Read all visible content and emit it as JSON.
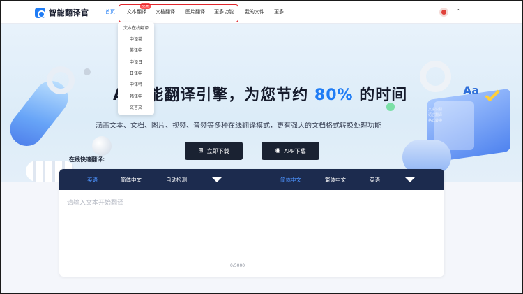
{
  "header": {
    "app_name": "智能翻译官",
    "nav": [
      {
        "label": "首页",
        "active": true
      },
      {
        "label": "文本翻译",
        "active": false,
        "badge": "免费"
      },
      {
        "label": "文档翻译",
        "active": false
      },
      {
        "label": "图片翻译",
        "active": false
      },
      {
        "label": "更多功能",
        "active": false
      },
      {
        "label": "我的文件",
        "active": false
      },
      {
        "label": "更多",
        "active": false
      }
    ]
  },
  "dropdown": {
    "items": [
      "文本在线翻译",
      "中译英",
      "英译中",
      "中译日",
      "日译中",
      "中译韩",
      "韩译中",
      "文言文"
    ]
  },
  "hero": {
    "title_lead": "AI智能翻译引擎，为您节约",
    "title_highlight": "80%",
    "title_tail": "的时间",
    "subtitle": "涵盖文本、文档、图片、视频、音频等多种在线翻译模式，更有强大的文档格式转换处理功能",
    "download_label": "立即下载",
    "app_download_label": "APP下载"
  },
  "translator": {
    "section_label": "在线快速翻译:",
    "source_langs": [
      "英语",
      "简体中文",
      "自动检测"
    ],
    "target_langs": [
      "简体中文",
      "繁体中文",
      "英语"
    ],
    "placeholder": "请输入文本开始翻译",
    "char_count": "0/5000"
  },
  "colors": {
    "accent": "#1f7cf5",
    "lang_bar": "#1c2b4e",
    "highlight_border": "#e0262c"
  }
}
